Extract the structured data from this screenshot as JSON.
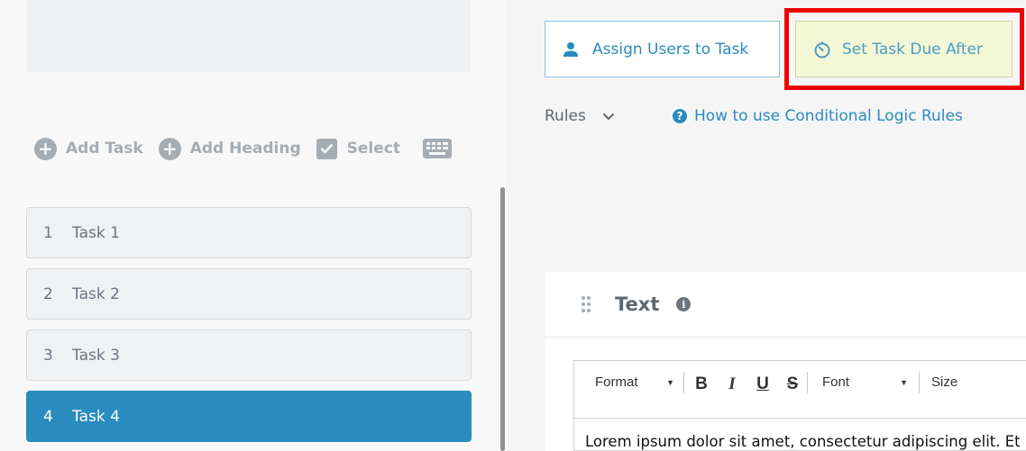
{
  "left_toolbar": {
    "add_task": "Add Task",
    "add_heading": "Add Heading",
    "select": "Select",
    "keyboard_icon": "keyboard-icon"
  },
  "tasks": [
    {
      "number": "1",
      "title": "Task 1",
      "active": false
    },
    {
      "number": "2",
      "title": "Task 2",
      "active": false
    },
    {
      "number": "3",
      "title": "Task 3",
      "active": false
    },
    {
      "number": "4",
      "title": "Task 4",
      "active": true
    }
  ],
  "actions": {
    "assign_users": "Assign Users to Task",
    "set_due": "Set Task Due After"
  },
  "rules": {
    "label": "Rules",
    "help_link": "How to use Conditional Logic Rules"
  },
  "card": {
    "title": "Text",
    "toolbar": {
      "format": "Format",
      "bold": "B",
      "italic": "I",
      "underline": "U",
      "strike": "S",
      "font": "Font",
      "size": "Size"
    },
    "content": "Lorem ipsum dolor sit amet, consectetur adipiscing elit. Et"
  },
  "colors": {
    "accent": "#2a8bbf",
    "highlight_border": "#ee0000",
    "due_button_bg": "#f2f8d6"
  }
}
